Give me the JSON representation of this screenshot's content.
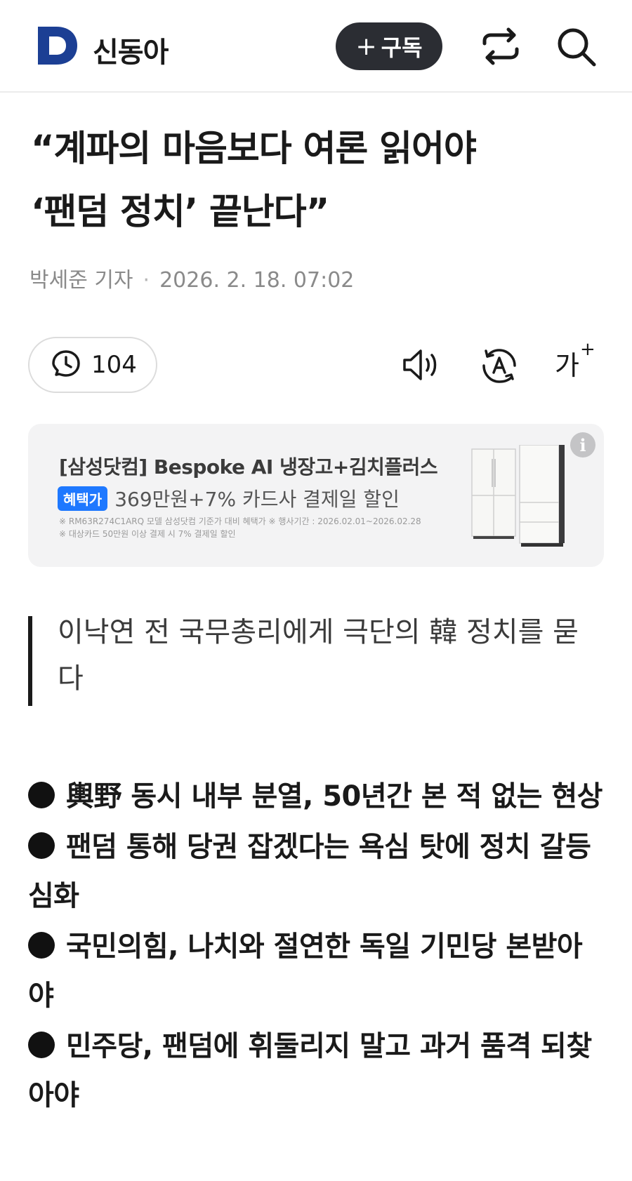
{
  "header": {
    "logo_letter": "D",
    "brand": "신동아",
    "subscribe_label": "구독",
    "share_icon": "share-icon",
    "search_icon": "search-icon"
  },
  "article": {
    "title_line1": "“계파의 마음보다 여론 읽어야",
    "title_line2": "‘팬덤 정치’ 끝난다”",
    "author": "박세준 기자",
    "date": "2026. 2. 18. 07:02",
    "comment_count": "104",
    "font_size_label": "가",
    "quote": "이낙연 전 국무총리에게 극단의 韓 정치를 묻다",
    "bullets": [
      "輿野 동시 내부 분열, 50년간 본 적 없는 현상",
      "팬덤 통해 당권 잡겠다는 욕심 탓에 정치 갈등 심화",
      "국민의힘, 나치와 절연한 독일 기민당 본받아야",
      "민주당, 팬덤에 휘둘리지 말고 과거 품격 되찾아야"
    ]
  },
  "ad": {
    "headline": "[삼성닷컴] Bespoke AI 냉장고+김치플러스",
    "badge": "혜택가",
    "offer": "369만원+7% 카드사 결제일 할인",
    "fine_print_1": "※ RM63R274C1ARQ 모델 삼성닷컴 기준가 대비 혜택가 ※ 행사기간 : 2026.02.01~2026.02.28",
    "fine_print_2": "※ 대상카드 50만원 이상 결제 시 7% 결제일 할인",
    "info_label": "i"
  },
  "colors": {
    "subscribe_bg": "#2b2d33",
    "logo_blue": "#1c3f94",
    "badge_blue": "#1e78ff",
    "ad_bg": "#f3f3f4"
  }
}
